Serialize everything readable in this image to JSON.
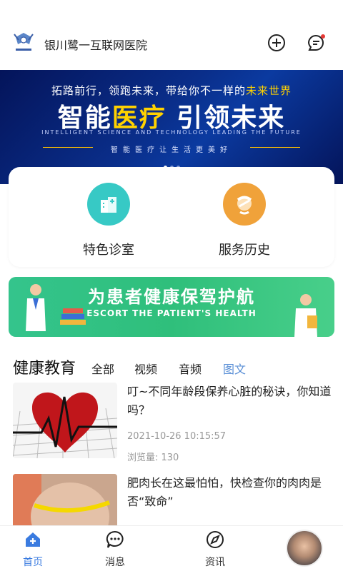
{
  "header": {
    "title": "银川鹭一互联网医院",
    "add_icon": "plus-circle-icon",
    "msg_icon": "message-icon",
    "has_badge": true
  },
  "banner": {
    "top_line_prefix": "拓路前行，领跑未来，带给你不一样的",
    "top_line_highlight": "未来世界",
    "big_part1": "智能",
    "big_part2": "医疗",
    "big_part3": " 引领未来",
    "en": "INTELLIGENT SCIENCE AND TECHNOLOGY LEADING THE FUTURE",
    "sub": "智能医疗让生活更美好",
    "slides": 3,
    "active_slide": 1
  },
  "features": [
    {
      "label": "特色诊室",
      "icon": "hospital-icon",
      "color": "#37c9c5"
    },
    {
      "label": "服务历史",
      "icon": "bandaged-head-icon",
      "color": "#f0a23a"
    }
  ],
  "ad": {
    "title": "为患者健康保驾护航",
    "subtitle": "ESCORT THE PATIENT'S HEALTH"
  },
  "section": {
    "title": "健康教育",
    "tabs": [
      "全部",
      "视频",
      "音频",
      "图文"
    ],
    "active_tab": 3
  },
  "articles": [
    {
      "title": "叮~不同年龄段保养心脏的秘诀，你知道吗？",
      "date": "2021-10-26 10:15:57",
      "views": "浏览量: 130",
      "thumb": "heart-ecg-image"
    },
    {
      "title": "肥肉长在这最怕怕，快检查你的肉肉是否“致命”",
      "thumb": "belly-measure-image"
    }
  ],
  "tabbar": [
    {
      "label": "首页",
      "icon": "home-icon",
      "active": true
    },
    {
      "label": "消息",
      "icon": "chat-icon",
      "active": false
    },
    {
      "label": "资讯",
      "icon": "compass-icon",
      "active": false
    }
  ],
  "colors": {
    "accent": "#3a7be0",
    "tab_active": "#5a8fd6",
    "badge": "#e53935"
  }
}
